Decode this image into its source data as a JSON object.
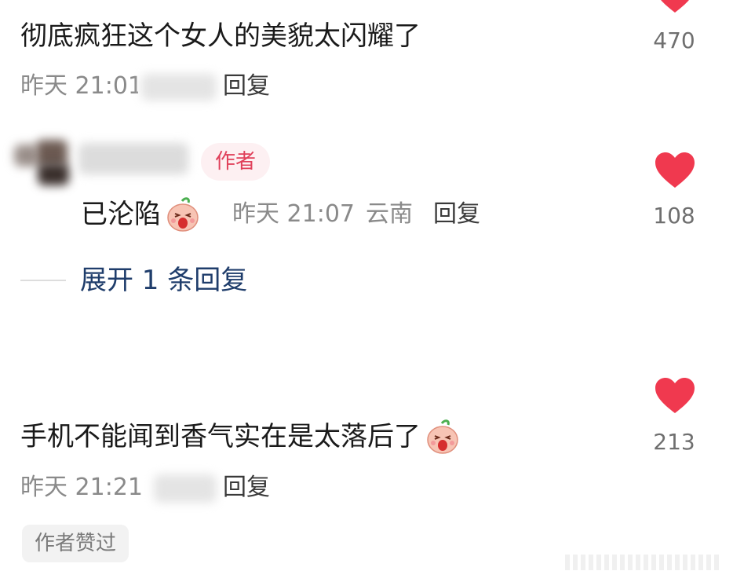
{
  "comments": [
    {
      "text": "彻底疯狂这个女人的美貌太闪耀了",
      "time": "昨天 21:01",
      "reply_label": "回复",
      "likes": "470"
    },
    {
      "author_tag": "作者",
      "text": "已沦陷",
      "time": "昨天 21:07",
      "location": "云南",
      "reply_label": "回复",
      "likes": "108",
      "emoji": "scream-peach-emoji"
    },
    {
      "text": "手机不能闻到香气实在是太落后了",
      "time": "昨天 21:21",
      "reply_label": "回复",
      "likes": "213",
      "emoji": "scream-peach-emoji",
      "badge": "作者赞过"
    }
  ],
  "expand_replies": "展开 1 条回复",
  "colors": {
    "heart": "#f0394f",
    "author_tag_bg": "#fdf0f2",
    "author_tag_text": "#e0405a",
    "expand_link": "#1f3d6b"
  }
}
